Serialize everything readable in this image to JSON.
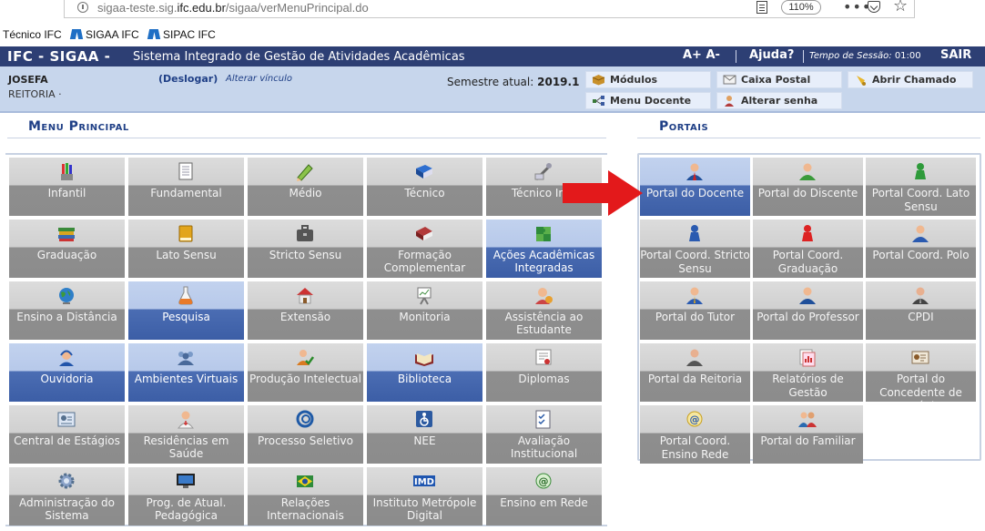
{
  "browser": {
    "url_prefix": "sigaa-teste.sig.",
    "url_domain": "ifc.edu.br",
    "url_path": "/sigaa/verMenuPrincipal.do",
    "zoom": "110%",
    "bookmarks": [
      "Técnico IFC",
      "SIGAA IFC",
      "SIPAC IFC"
    ]
  },
  "header": {
    "brand": "IFC - SIGAA -",
    "system_name": "Sistema Integrado de Gestão de Atividades Acadêmicas",
    "font_controls": "A+  A-",
    "help": "Ajuda?",
    "session_label": "Tempo de Sessão:",
    "session_time": "01:00",
    "exit": "SAIR"
  },
  "user": {
    "name": "JOSEFA",
    "unit": "REITORIA ·",
    "logout": "(Deslogar)",
    "change_link": "Alterar vínculo",
    "semester_label": "Semestre atual:",
    "semester_value": "2019.1"
  },
  "quick_buttons": [
    "Módulos",
    "Caixa Postal",
    "Abrir Chamado",
    "Menu Docente",
    "Alterar senha"
  ],
  "menu": {
    "title": "Menu Principal",
    "tiles": [
      {
        "label": "Infantil",
        "icon": "crayons-icon",
        "active": false
      },
      {
        "label": "Fundamental",
        "icon": "notebook-icon",
        "active": false
      },
      {
        "label": "Médio",
        "icon": "pencil-icon",
        "active": false
      },
      {
        "label": "Técnico",
        "icon": "blue-book-icon",
        "active": false
      },
      {
        "label": "Técnico Inte",
        "icon": "tools-icon",
        "active": false
      },
      {
        "label": "Graduação",
        "icon": "books-stack-icon",
        "active": false
      },
      {
        "label": "Lato Sensu",
        "icon": "yellow-book-icon",
        "active": false
      },
      {
        "label": "Stricto Sensu",
        "icon": "briefcase-icon",
        "active": false
      },
      {
        "label": "Formação Complementar",
        "icon": "red-book-icon",
        "active": false
      },
      {
        "label": "Ações Acadêmicas Integradas",
        "icon": "puzzle-icon",
        "active": true
      },
      {
        "label": "Ensino a Distância",
        "icon": "globe-icon",
        "active": false
      },
      {
        "label": "Pesquisa",
        "icon": "flask-icon",
        "active": true
      },
      {
        "label": "Extensão",
        "icon": "house-icon",
        "active": false
      },
      {
        "label": "Monitoria",
        "icon": "easel-icon",
        "active": false
      },
      {
        "label": "Assistência ao Estudante",
        "icon": "student-help-icon",
        "active": false
      },
      {
        "label": "Ouvidoria",
        "icon": "headset-icon",
        "active": true
      },
      {
        "label": "Ambientes Virtuais",
        "icon": "group-icon",
        "active": true
      },
      {
        "label": "Produção Intelectual",
        "icon": "author-check-icon",
        "active": false
      },
      {
        "label": "Biblioteca",
        "icon": "open-book-icon",
        "active": true
      },
      {
        "label": "Diplomas",
        "icon": "diploma-icon",
        "active": false
      },
      {
        "label": "Central de Estágios",
        "icon": "id-card-icon",
        "active": false
      },
      {
        "label": "Residências em Saúde",
        "icon": "doctor-icon",
        "active": false
      },
      {
        "label": "Processo Seletivo",
        "icon": "swirl-icon",
        "active": false
      },
      {
        "label": "NEE",
        "icon": "wheelchair-icon",
        "active": false
      },
      {
        "label": "Avaliação Institucional",
        "icon": "checklist-icon",
        "active": false
      },
      {
        "label": "Administração do Sistema",
        "icon": "gear-icon",
        "active": false
      },
      {
        "label": "Prog. de Atual. Pedagógica",
        "icon": "monitor-icon",
        "active": false
      },
      {
        "label": "Relações Internacionais",
        "icon": "flag-icon",
        "active": false
      },
      {
        "label": "Instituto Metrópole Digital",
        "icon": "imd-logo-icon",
        "active": false
      },
      {
        "label": "Ensino em Rede",
        "icon": "web-icon",
        "active": false
      }
    ]
  },
  "portals": {
    "title": "Portais",
    "tiles": [
      {
        "label": "Portal do Docente",
        "icon": "teacher-icon",
        "active": true
      },
      {
        "label": "Portal do Discente",
        "icon": "student-icon",
        "active": false
      },
      {
        "label": "Portal Coord. Lato Sensu",
        "icon": "green-pawn-icon",
        "active": false
      },
      {
        "label": "Portal Coord. Stricto Sensu",
        "icon": "blue-pawn-icon",
        "active": false
      },
      {
        "label": "Portal Coord. Graduação",
        "icon": "red-pawn-icon",
        "active": false
      },
      {
        "label": "Portal Coord. Polo",
        "icon": "user-icon",
        "active": false
      },
      {
        "label": "Portal do Tutor",
        "icon": "tutor-icon",
        "active": false
      },
      {
        "label": "Portal do Professor",
        "icon": "professor-icon",
        "active": false
      },
      {
        "label": "CPDI",
        "icon": "manager-icon",
        "active": false
      },
      {
        "label": "Portal da Reitoria",
        "icon": "rector-icon",
        "active": false
      },
      {
        "label": "Relatórios de Gestão",
        "icon": "reports-icon",
        "active": false
      },
      {
        "label": "Portal do Concedente de Estágio",
        "icon": "badge-icon",
        "active": false
      },
      {
        "label": "Portal Coord. Ensino Rede",
        "icon": "network-icon",
        "active": false
      },
      {
        "label": "Portal do Familiar",
        "icon": "family-icon",
        "active": false
      }
    ]
  },
  "colors": {
    "header": "#2d3f74",
    "infobar": "#c7d6ec",
    "active_tile": "#3c5ea6",
    "tile": "#8c8c8c",
    "arrow": "#e3191b"
  }
}
